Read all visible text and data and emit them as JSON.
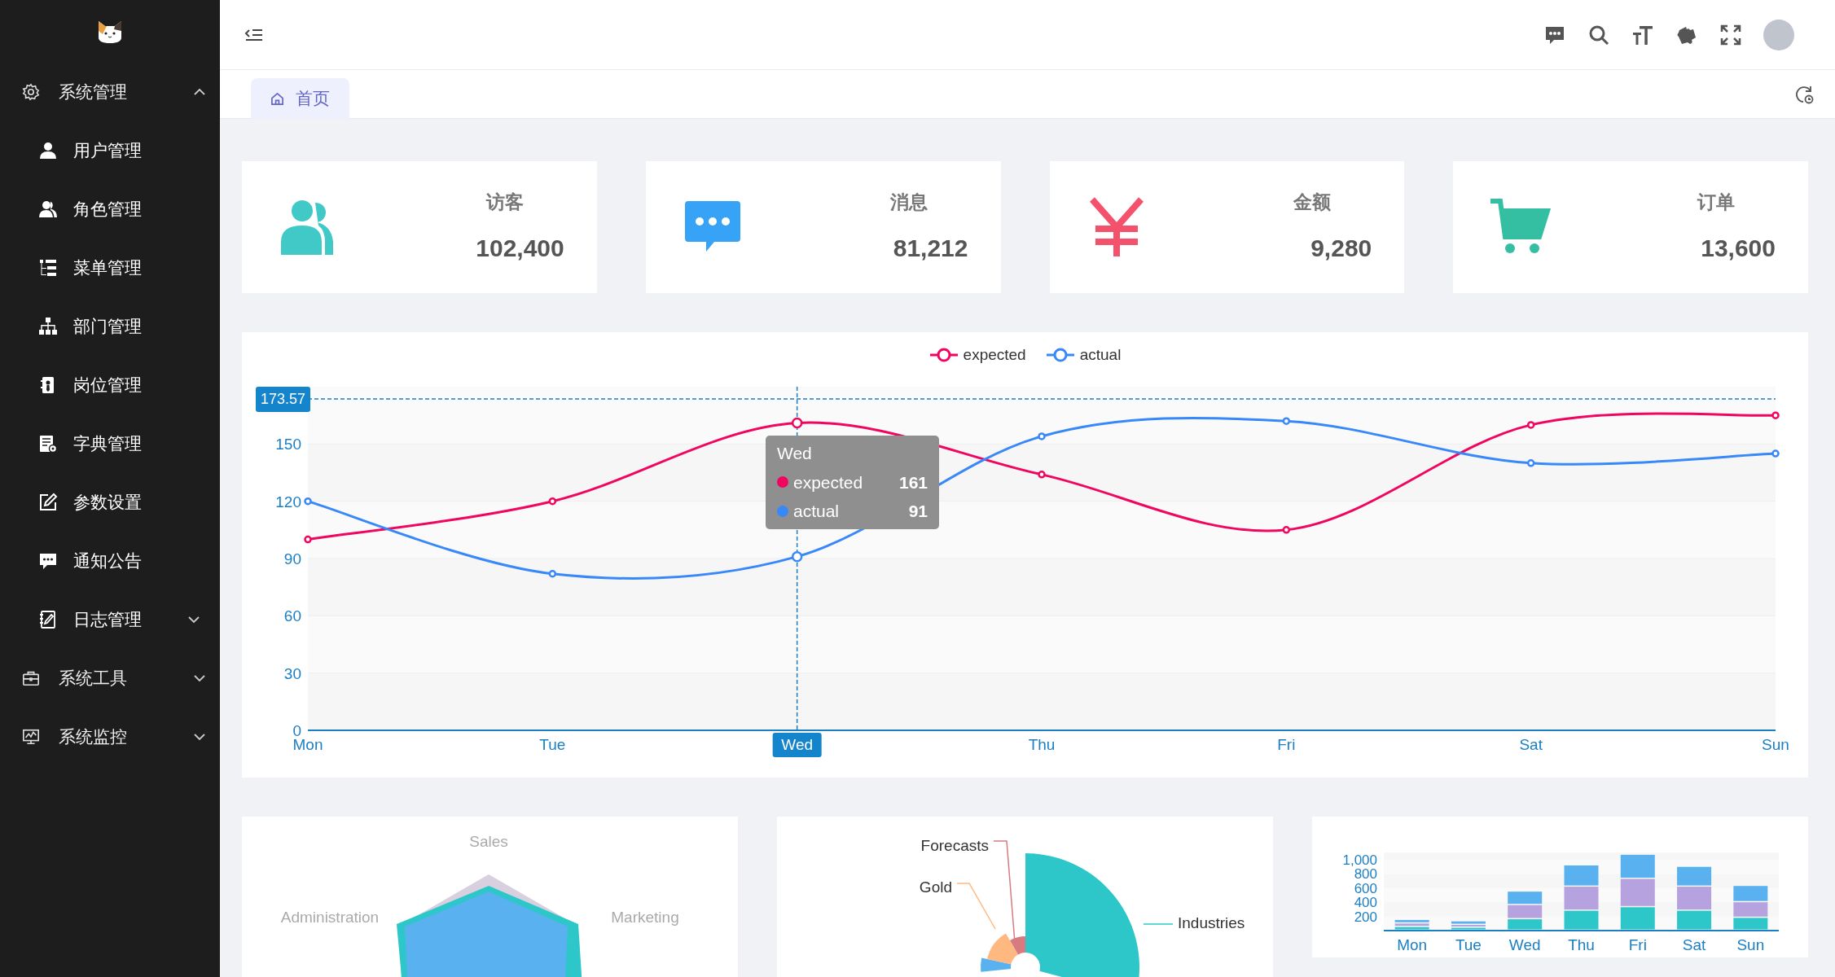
{
  "sidebar": {
    "menu": [
      {
        "label": "系统管理",
        "expanded": true,
        "children": [
          {
            "label": "用户管理"
          },
          {
            "label": "角色管理"
          },
          {
            "label": "菜单管理"
          },
          {
            "label": "部门管理"
          },
          {
            "label": "岗位管理"
          },
          {
            "label": "字典管理"
          },
          {
            "label": "参数设置"
          },
          {
            "label": "通知公告"
          },
          {
            "label": "日志管理",
            "expanded": false
          }
        ]
      },
      {
        "label": "系统工具",
        "expanded": false
      },
      {
        "label": "系统监控",
        "expanded": false
      }
    ]
  },
  "tabs": [
    {
      "label": "首页",
      "selected": true
    }
  ],
  "stat_cards": [
    {
      "kind": "visitors",
      "label": "访客",
      "value": "102,400",
      "color": "#40c9c6"
    },
    {
      "kind": "messages",
      "label": "消息",
      "value": "81,212",
      "color": "#36a3f7"
    },
    {
      "kind": "money",
      "label": "金额",
      "value": "9,280",
      "color": "#f4516c"
    },
    {
      "kind": "orders",
      "label": "订单",
      "value": "13,600",
      "color": "#34bfa3"
    }
  ],
  "line_chart": {
    "chart_data": {
      "type": "line",
      "grid": true,
      "categories": [
        "Mon",
        "Tue",
        "Wed",
        "Thu",
        "Fri",
        "Sat",
        "Sun"
      ],
      "ylim": [
        0,
        180
      ],
      "yticks": [
        0,
        30,
        60,
        90,
        120,
        150
      ],
      "ref_lines": [
        {
          "axis": "y",
          "value": 173.57,
          "label": "173.57"
        },
        {
          "axis": "x",
          "value": "Wed"
        }
      ],
      "series": [
        {
          "name": "expected",
          "color": "#f0065f",
          "marker": "circle",
          "values": [
            100,
            120,
            161,
            134,
            105,
            160,
            165
          ]
        },
        {
          "name": "actual",
          "color": "#3888fa",
          "marker": "circle",
          "values": [
            120,
            82,
            91,
            154,
            162,
            140,
            145
          ]
        }
      ]
    },
    "tooltip": {
      "title": "Wed",
      "rows": [
        {
          "name": "expected",
          "value": "161"
        },
        {
          "name": "actual",
          "value": "91"
        }
      ]
    }
  },
  "radar_chart": {
    "indicators": [
      "Sales",
      "Administration",
      "Marketing"
    ]
  },
  "pie_chart": {
    "labels": [
      "Forecasts",
      "Gold",
      "Industries"
    ]
  },
  "bar_chart": {
    "chart_data": {
      "type": "bar",
      "stacked": true,
      "categories": [
        "Mon",
        "Tue",
        "Wed",
        "Thu",
        "Fri",
        "Sat",
        "Sun"
      ],
      "ylim": [
        0,
        1100
      ],
      "yticks": [
        {
          "value": 200,
          "label": "200"
        },
        {
          "value": 400,
          "label": "400"
        },
        {
          "value": 600,
          "label": "600"
        },
        {
          "value": 800,
          "label": "800"
        },
        {
          "value": 1000,
          "label": "1,000"
        }
      ],
      "series": [
        {
          "color": "#2ec7c9",
          "values": [
            50,
            40,
            160,
            280,
            330,
            280,
            180
          ]
        },
        {
          "color": "#b6a2de",
          "values": [
            50,
            40,
            200,
            340,
            400,
            340,
            220
          ]
        },
        {
          "color": "#5ab1ef",
          "values": [
            50,
            50,
            190,
            300,
            340,
            280,
            230
          ]
        }
      ]
    }
  }
}
